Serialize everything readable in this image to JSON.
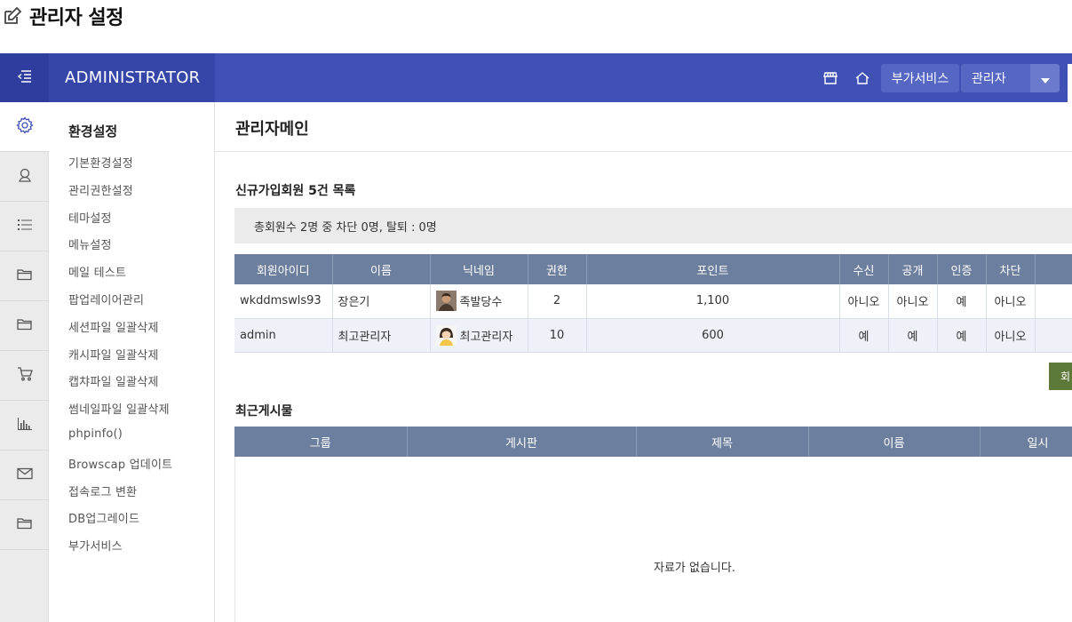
{
  "page": {
    "title": "관리자 설정",
    "icon": "edit-icon"
  },
  "topbar": {
    "brand": "ADMINISTRATOR",
    "menu_icon": "menu-collapse-icon",
    "store_icon": "store-icon",
    "home_icon": "home-icon",
    "addon_button": "부가서비스",
    "admin_button": "관리자",
    "colors": {
      "bar": "#3f51b5",
      "brand_bg": "#3646a8"
    }
  },
  "rail": {
    "items": [
      {
        "icon": "gear-icon",
        "active": true
      },
      {
        "icon": "user-icon"
      },
      {
        "icon": "list-icon"
      },
      {
        "icon": "folder-icon"
      },
      {
        "icon": "folder-icon"
      },
      {
        "icon": "cart-icon"
      },
      {
        "icon": "chart-icon"
      },
      {
        "icon": "mail-icon"
      },
      {
        "icon": "folder-icon"
      }
    ]
  },
  "sidebar": {
    "title": "환경설정",
    "items": [
      "기본환경설정",
      "관리권한설정",
      "테마설정",
      "메뉴설정",
      "메일 테스트",
      "팝업레이어관리",
      "세션파일 일괄삭제",
      "캐시파일 일괄삭제",
      "캡챠파일 일괄삭제",
      "썸네일파일 일괄삭제",
      "phpinfo()",
      "Browscap 업데이트",
      "접속로그 변환",
      "DB업그레이드",
      "부가서비스"
    ]
  },
  "main": {
    "title": "관리자메인",
    "members": {
      "title": "신규가입회원 5건 목록",
      "summary": "총회원수 2명 중 차단 0명, 탈퇴 : 0명",
      "headers": [
        "회원아이디",
        "이름",
        "닉네임",
        "권한",
        "포인트",
        "수신",
        "공개",
        "인증",
        "차단"
      ],
      "rows": [
        {
          "id": "wkddmswls93",
          "name": "장은기",
          "nick": "족발당수",
          "level": "2",
          "point": "1,100",
          "mail": "아니오",
          "open": "아니오",
          "cert": "예",
          "block": "아니오"
        },
        {
          "id": "admin",
          "name": "최고관리자",
          "nick": "최고관리자",
          "level": "10",
          "point": "600",
          "mail": "예",
          "open": "예",
          "cert": "예",
          "block": "아니오"
        }
      ],
      "more_button": "회"
    },
    "board": {
      "title": "최근게시물",
      "headers": [
        "그룹",
        "게시판",
        "제목",
        "이름",
        "일시"
      ],
      "empty_message": "자료가 없습니다."
    }
  }
}
